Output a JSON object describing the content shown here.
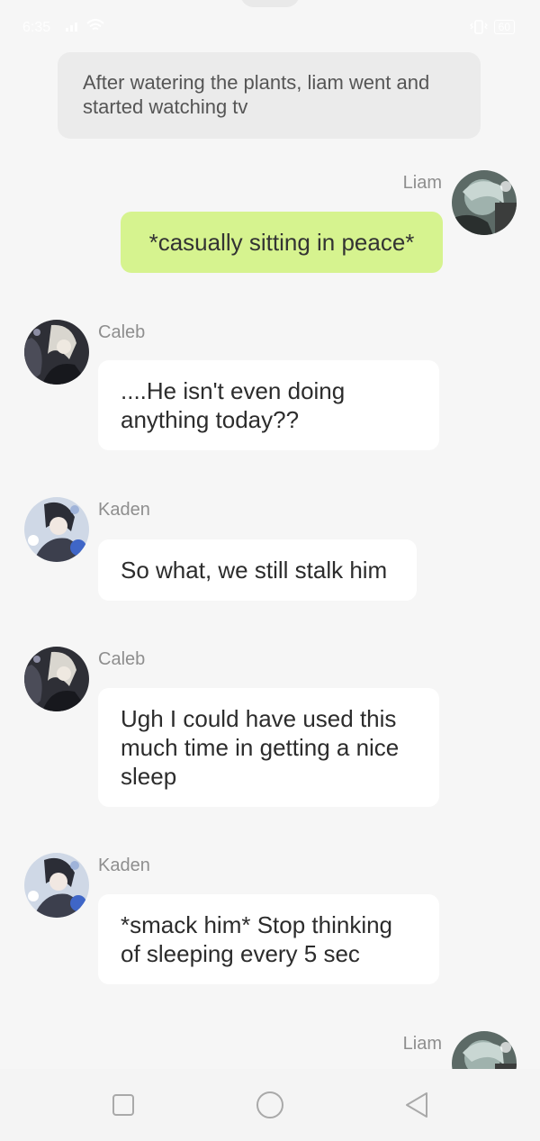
{
  "status": {
    "time": "6:35",
    "battery": "60"
  },
  "narration": "After watering the plants, liam went and started watching tv",
  "messages": [
    {
      "sender": "Liam",
      "text": "*casually sitting in peace*",
      "side": "right"
    },
    {
      "sender": "Caleb",
      "text": "....He isn't even doing anything today??",
      "side": "left"
    },
    {
      "sender": "Kaden",
      "text": "So what, we still stalk him",
      "side": "left"
    },
    {
      "sender": "Caleb",
      "text": "Ugh I could have used this much time in getting a nice sleep",
      "side": "left"
    },
    {
      "sender": "Kaden",
      "text": "*smack him* Stop thinking of sleeping every 5 sec",
      "side": "left"
    },
    {
      "sender": "Liam",
      "text": "",
      "side": "right"
    }
  ],
  "icons": {
    "recents": "square-icon",
    "home": "circle-icon",
    "back": "triangle-back-icon",
    "wifi": "wifi-icon",
    "signal": "signal-icon",
    "vibrate": "vibrate-icon",
    "battery": "battery-icon"
  },
  "colors": {
    "background": "#f6f6f6",
    "narration_bg": "#ebebeb",
    "own_bubble": "#d6f38f",
    "other_bubble": "#ffffff",
    "name_text": "#8e8e8e"
  }
}
